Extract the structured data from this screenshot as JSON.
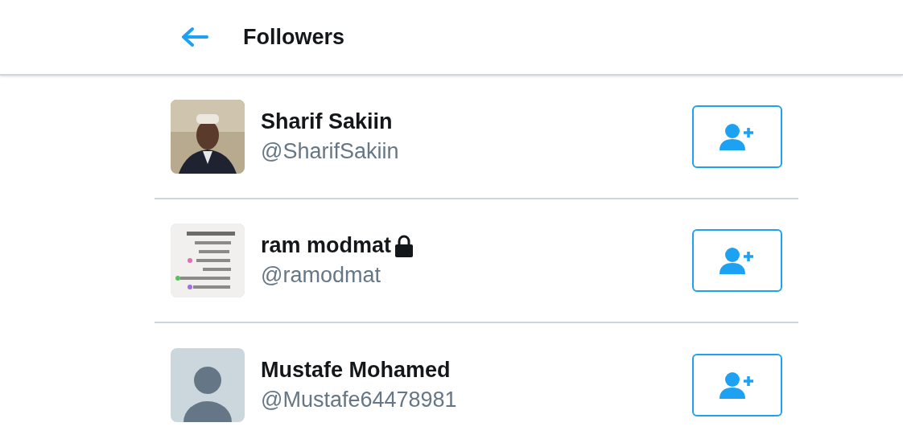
{
  "header": {
    "title": "Followers"
  },
  "followers": [
    {
      "name": "Sharif Sakiin",
      "handle": "@SharifSakiin",
      "locked": false
    },
    {
      "name": "ram modmat",
      "handle": "@ramodmat",
      "locked": true
    },
    {
      "name": "Mustafe Mohamed",
      "handle": "@Mustafe64478981",
      "locked": false,
      "avatar": {
        "kind": "default"
      }
    }
  ]
}
